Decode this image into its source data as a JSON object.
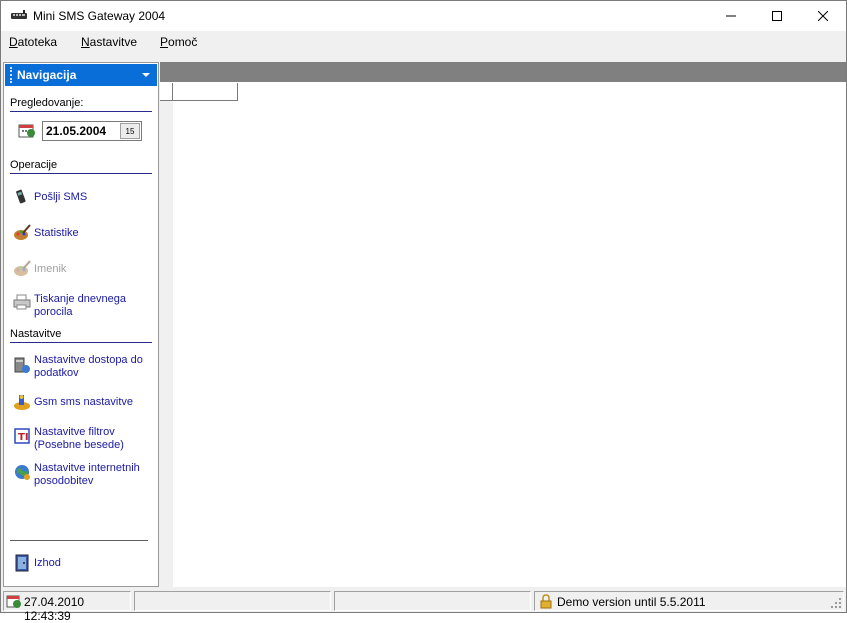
{
  "window": {
    "title": "Mini SMS Gateway 2004",
    "app_icon": "sms-phone-icon"
  },
  "menu": [
    {
      "label_u": "D",
      "label_rest": "atoteka"
    },
    {
      "label_u": "N",
      "label_rest": "astavitve"
    },
    {
      "label_u": "P",
      "label_rest": "omoč"
    }
  ],
  "nav": {
    "header": "Navigacija",
    "sections": {
      "browse": "Pregledovanje:",
      "operations": "Operacije",
      "settings": "Nastavitve"
    },
    "date": "21.05.2004",
    "date_button": "15",
    "operations": [
      {
        "label": "Pošlji SMS",
        "icon": "mobile-phone-icon"
      },
      {
        "label": "Statistike",
        "icon": "statistics-icon"
      },
      {
        "label": "Imenik",
        "icon": "phonebook-icon"
      },
      {
        "label_line1": "Tiskanje dnevnega",
        "label_line2": "porocila",
        "icon": "printer-icon"
      }
    ],
    "settings": [
      {
        "label_line1": "Nastavitve dostopa do",
        "label_line2": "podatkov",
        "icon": "database-access-icon"
      },
      {
        "label": "Gsm sms nastavitve",
        "icon": "gsm-settings-icon"
      },
      {
        "label_line1": "Nastavitve filtrov",
        "label_line2": "(Posebne besede)",
        "icon": "filter-icon"
      },
      {
        "label_line1": "Nastavitve internetnih",
        "label_line2": "posodobitev",
        "icon": "internet-update-icon"
      }
    ],
    "exit": {
      "label": "Izhod",
      "icon": "exit-door-icon"
    }
  },
  "status": {
    "datetime": "27.04.2010 12:43:39",
    "panel2": "",
    "panel3": "",
    "demo": "Demo version until 5.5.2011"
  }
}
